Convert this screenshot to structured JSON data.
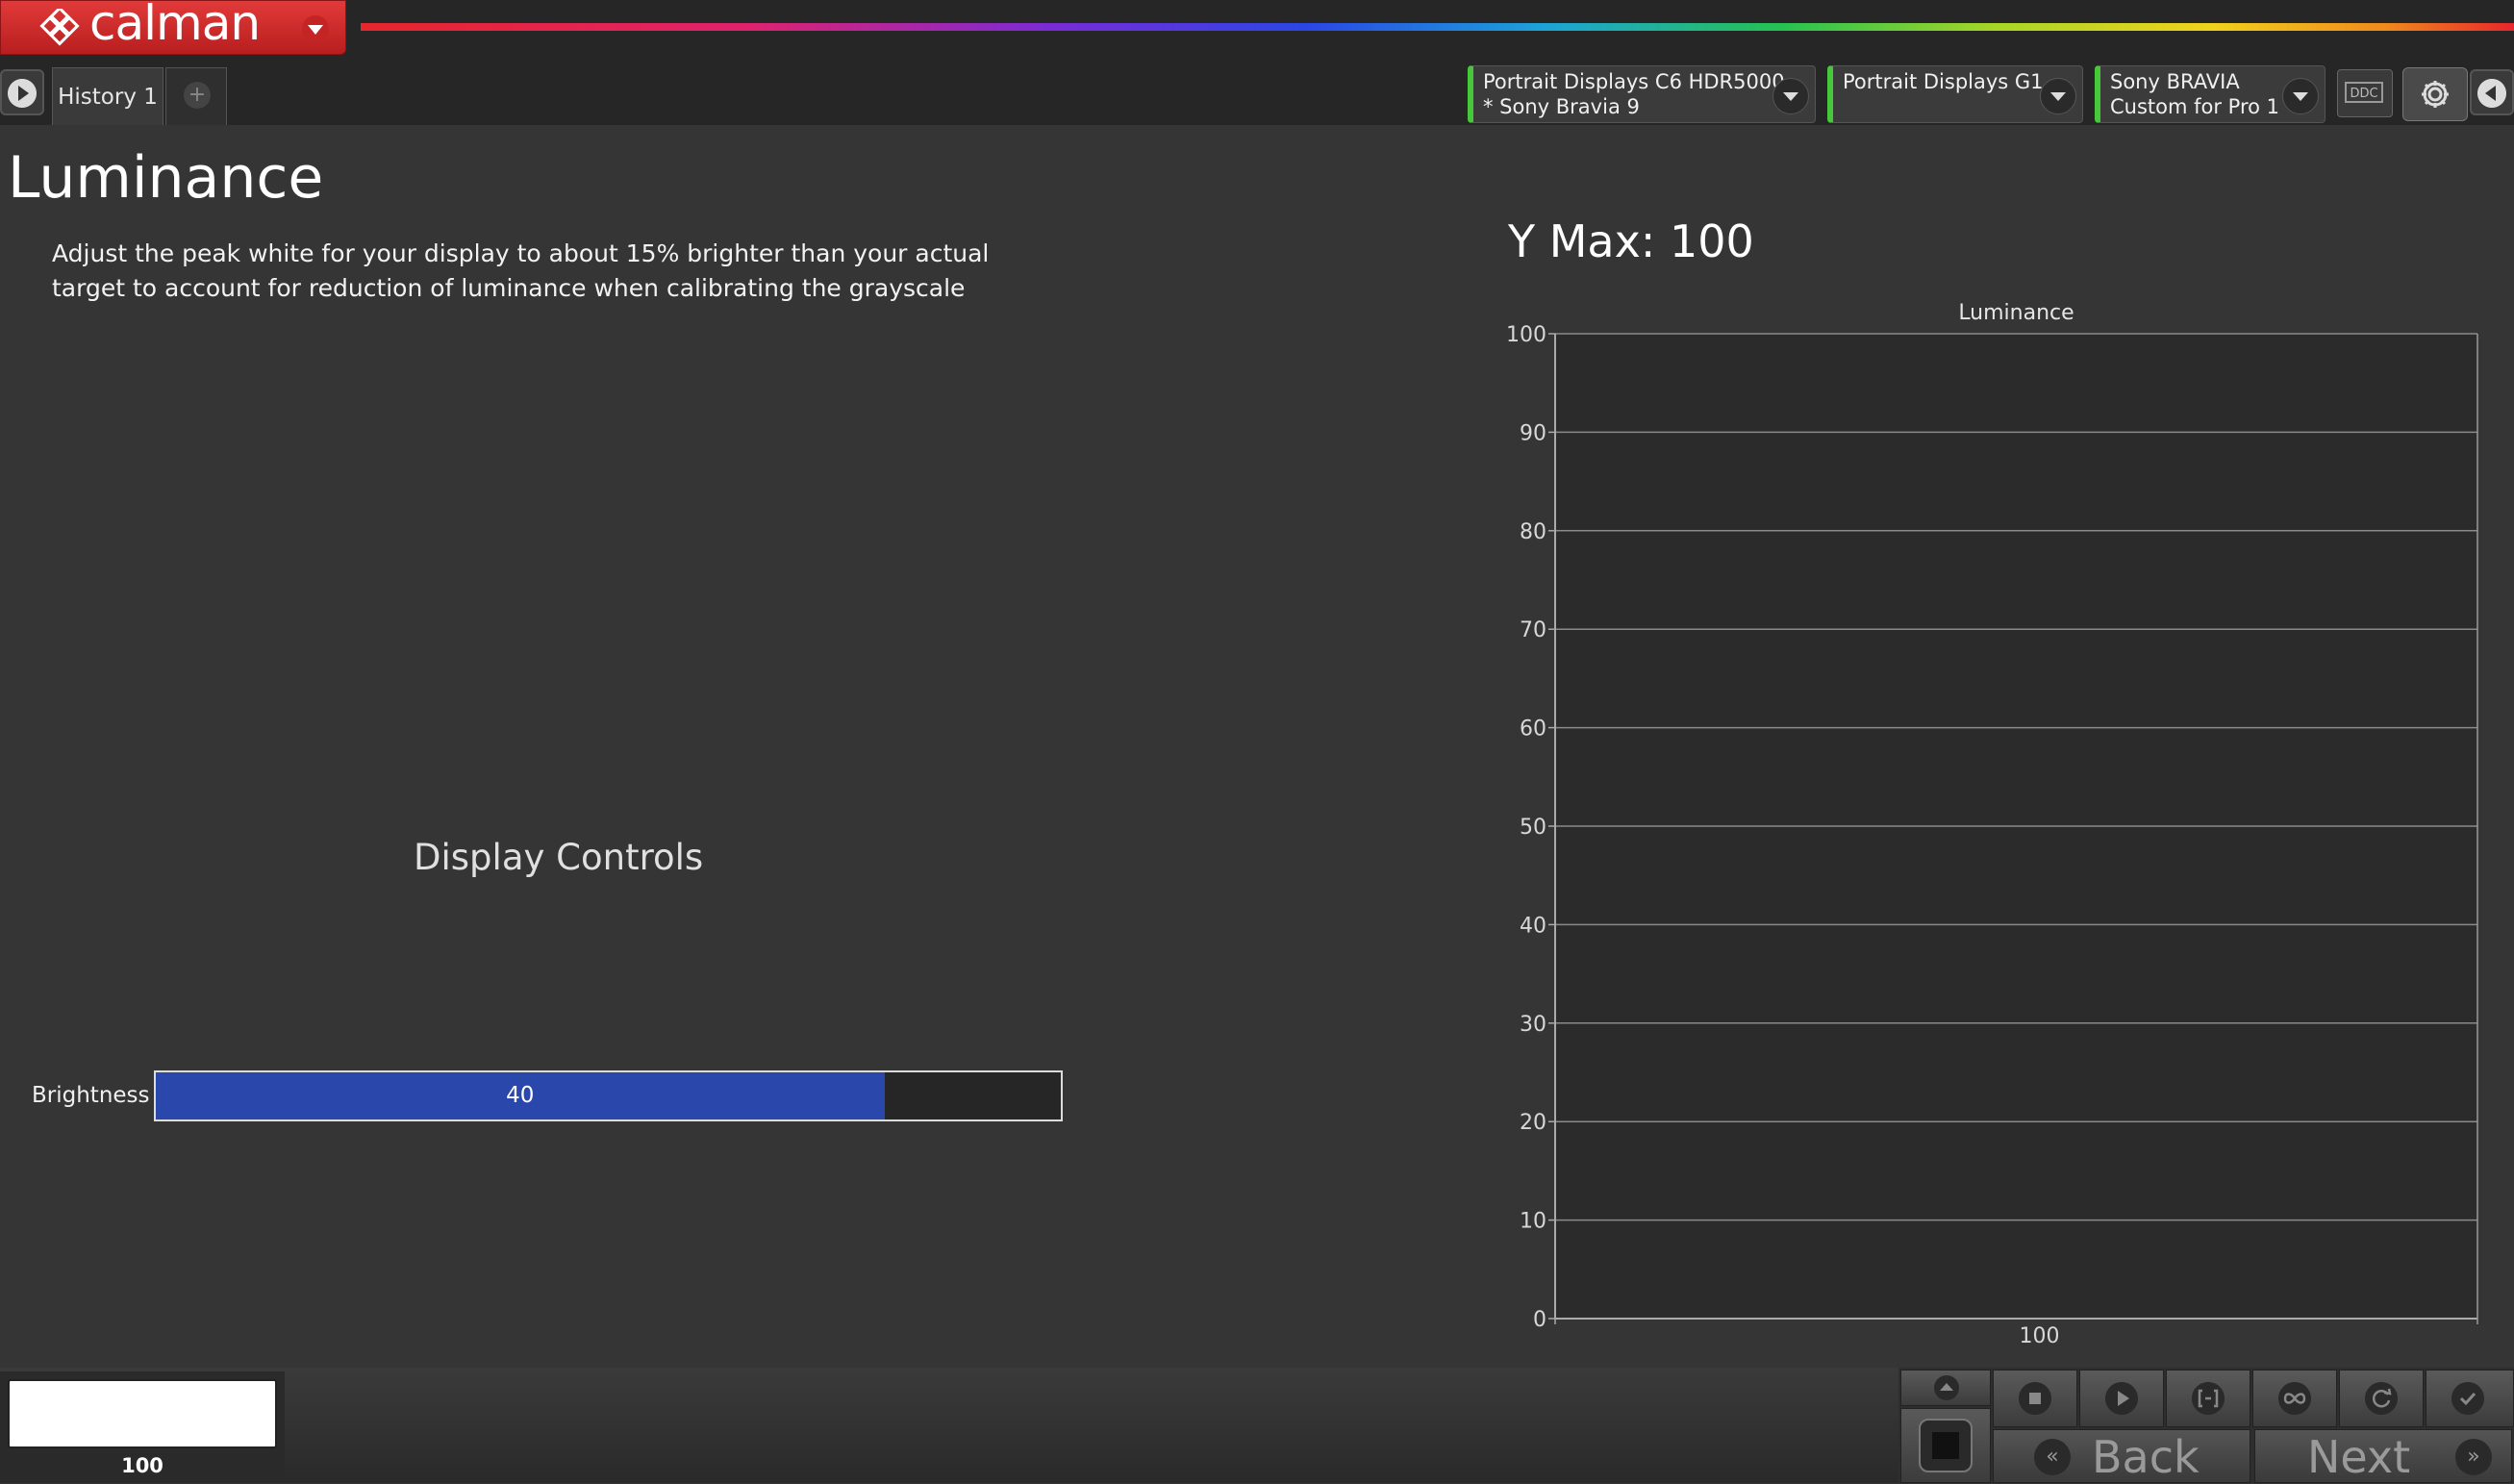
{
  "app": {
    "name": "calman"
  },
  "tabs": [
    {
      "label": "History 1"
    },
    {
      "label": "+"
    }
  ],
  "devices": [
    {
      "line1": "Portrait Displays C6 HDR5000",
      "line2": "* Sony Bravia 9",
      "status_color": "#46c83a"
    },
    {
      "line1": "Portrait Displays G1",
      "line2": "",
      "status_color": "#46c83a"
    },
    {
      "line1": "Sony BRAVIA",
      "line2": "Custom for Pro 1",
      "status_color": "#46c83a"
    }
  ],
  "toolbar": {
    "ddc_label": "DDC"
  },
  "page": {
    "title": "Luminance",
    "instruction": "Adjust the peak white for your display to about 15% brighter than your actual target to account for reduction of luminance when calibrating the grayscale"
  },
  "display_controls": {
    "heading": "Display Controls",
    "brightness": {
      "label": "Brightness",
      "value": "40",
      "fill_fraction": 0.805
    }
  },
  "ymax_label": "Y Max: 100",
  "chart_data": {
    "type": "bar",
    "title": "Luminance",
    "categories": [
      "100"
    ],
    "values": [
      0
    ],
    "ylim": [
      0,
      100
    ],
    "yticks": [
      "0",
      "10",
      "20",
      "30",
      "40",
      "50",
      "60",
      "70",
      "80",
      "90",
      "100"
    ],
    "grid": true,
    "xlabel": "",
    "ylabel": ""
  },
  "bottom": {
    "swatch": {
      "color": "#ffffff",
      "label": "100"
    },
    "back_label": "Back",
    "next_label": "Next"
  },
  "colors": {
    "accent_red": "#d42a2a",
    "slider_fill": "#2a48ac",
    "connected_green": "#46c83a"
  }
}
